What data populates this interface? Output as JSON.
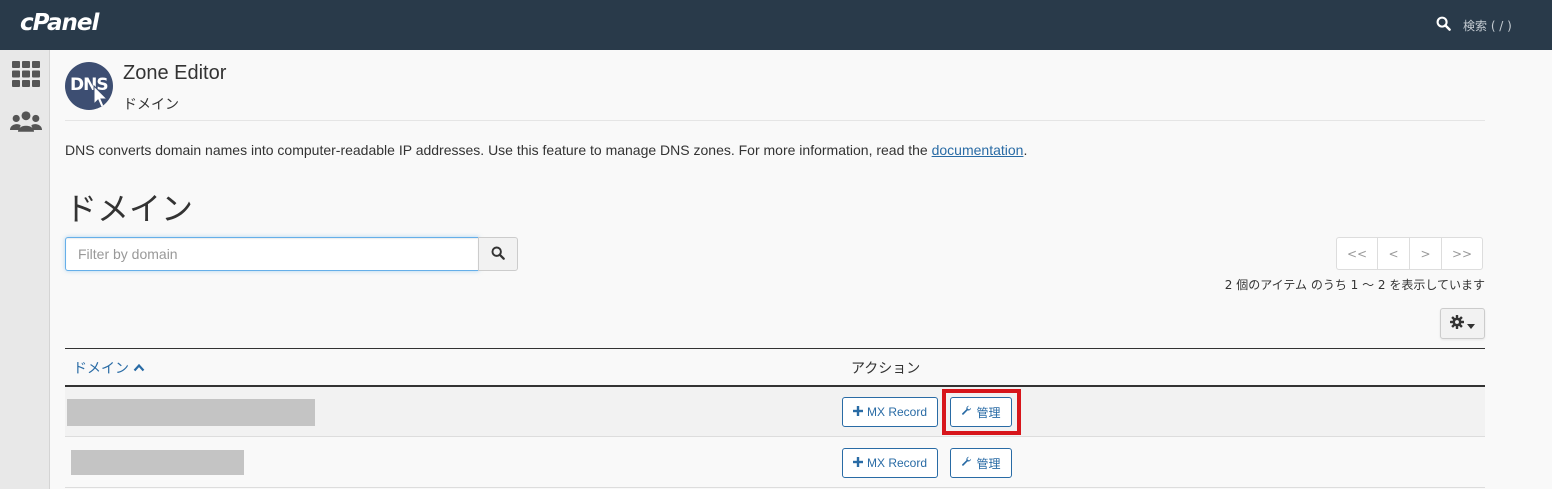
{
  "app": {
    "logo": "cPanel"
  },
  "topbar": {
    "search_label": "検索 ( / )",
    "search_icon": "search-icon"
  },
  "sidebar": {
    "items": [
      {
        "icon": "grid-icon"
      },
      {
        "icon": "users-icon"
      }
    ]
  },
  "header": {
    "logo_text": "DNS",
    "title": "Zone Editor",
    "subtitle": "ドメイン"
  },
  "description": {
    "text": "DNS converts domain names into computer-readable IP addresses. Use this feature to manage DNS zones. For more information, read the ",
    "link": "documentation",
    "end": "."
  },
  "section": {
    "heading": "ドメイン"
  },
  "filter": {
    "placeholder": "Filter by domain",
    "value": ""
  },
  "pagination": {
    "first": "<<",
    "prev": "<",
    "next": ">",
    "last": ">>",
    "summary": "2 個のアイテム のうち 1 ～ 2 を表示しています"
  },
  "table": {
    "columns": {
      "domain": "ドメイン",
      "action": "アクション"
    },
    "sort_icon": "chevron-up-icon",
    "rows": [
      {
        "domain": "",
        "mx_label": "MX Record",
        "manage_label": "管理"
      },
      {
        "domain": "",
        "mx_label": "MX Record",
        "manage_label": "管理"
      }
    ]
  },
  "colors": {
    "topbar": "#293a4a",
    "link": "#296ba5",
    "highlight": "#d7151b"
  }
}
